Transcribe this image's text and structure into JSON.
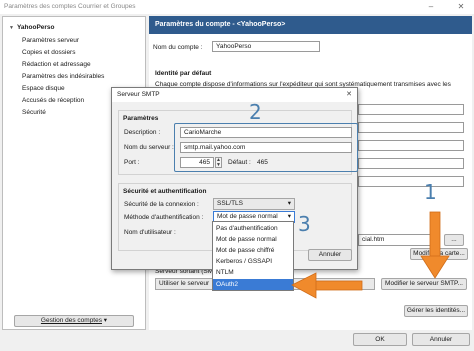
{
  "window": {
    "title": "Paramètres des comptes Courrier et Groupes",
    "minimize": "–",
    "close": "✕"
  },
  "sidebar": {
    "account": "YahooPerso",
    "items": [
      {
        "label": "Paramètres serveur"
      },
      {
        "label": "Copies et dossiers"
      },
      {
        "label": "Rédaction et adressage"
      },
      {
        "label": "Paramètres des indésirables"
      },
      {
        "label": "Espace disque"
      },
      {
        "label": "Accusés de réception"
      },
      {
        "label": "Sécurité"
      }
    ],
    "manage_button": "Gestion des comptes"
  },
  "main": {
    "header": "Paramètres du compte - <YahooPerso>",
    "account_name_label": "Nom du compte :",
    "account_name_value": "YahooPerso",
    "identity_heading": "Identité par défaut",
    "identity_desc": "Chaque compte dispose d'informations sur l'expéditeur qui sont systématiquement transmises avec les",
    "signature_file": "cial.htm",
    "browse_button": "...",
    "vcard_button": "Modifier la carte...",
    "smtp_server_label": "Serveur sortant (SM",
    "smtp_server_value": "Utiliser le serveur",
    "edit_smtp_button": "Modifier le serveur SMTP...",
    "identities_button": "Gérer les identités...",
    "ok_button": "OK",
    "cancel_button": "Annuler"
  },
  "dialog": {
    "title": "Serveur SMTP",
    "close": "✕",
    "params_heading": "Paramètres",
    "description_label": "Description :",
    "description_value": "CarioMarche",
    "server_label": "Nom du serveur :",
    "server_value": "smtp.mail.yahoo.com",
    "port_label": "Port :",
    "port_value": "465",
    "default_label": "Défaut :",
    "default_value": "465",
    "security_heading": "Sécurité et authentification",
    "conn_security_label": "Sécurité de la connexion :",
    "conn_security_value": "SSL/TLS",
    "auth_method_label": "Méthode d'authentification :",
    "auth_method_value": "Mot de passe normal",
    "username_label": "Nom d'utilisateur :",
    "cancel_button": "Annuler",
    "auth_options": [
      "Pas d'authentification",
      "Mot de passe normal",
      "Mot de passe chiffré",
      "Kerberos / GSSAPI",
      "NTLM",
      "OAuth2"
    ],
    "auth_selected_index": 5
  },
  "annotations": {
    "step1": "1",
    "step2": "2",
    "step3": "3",
    "annotation_color": "#4b7fae",
    "arrow_color": "#f08a2c"
  }
}
